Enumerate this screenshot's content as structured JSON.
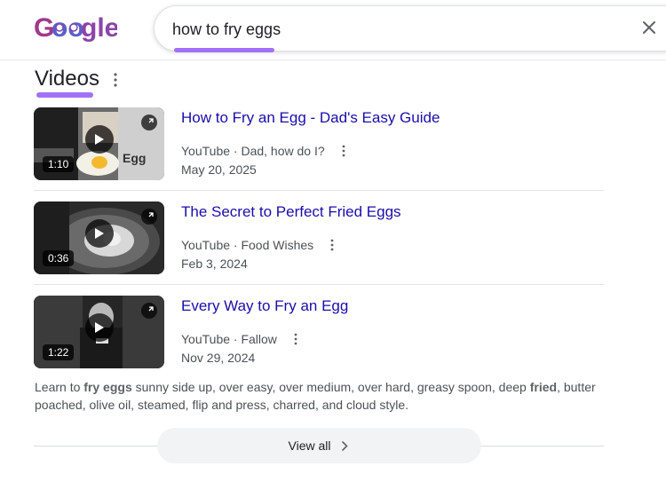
{
  "search": {
    "query": "how to fry eggs",
    "placeholder": "",
    "highlight_color": "#a371f7"
  },
  "logo": {
    "text": "Google"
  },
  "videos_section": {
    "title": "Videos",
    "items": [
      {
        "title": "How to Fry an Egg - Dad's Easy Guide",
        "source": "YouTube · Dad, how do I?",
        "date": "May 20, 2025",
        "duration": "1:10",
        "thumb_caption": "Egg"
      },
      {
        "title": "The Secret to Perfect Fried Eggs",
        "source": "YouTube · Food Wishes",
        "date": "Feb 3, 2024",
        "duration": "0:36"
      },
      {
        "title": "Every Way to Fry an Egg",
        "source": "YouTube · Fallow",
        "date": "Nov 29, 2024",
        "duration": "1:22"
      }
    ]
  },
  "snippet": {
    "prefix": "Learn to ",
    "highlight1": "fry eggs",
    "middle": " sunny side up, over easy, over medium, over hard, greasy spoon, deep ",
    "highlight2": "fried",
    "suffix": ", butter poached, olive oil, steamed, flip and press, charred, and cloud style."
  },
  "view_all": {
    "label": "View all"
  },
  "colors": {
    "link": "#1a0dab",
    "meta": "#4d5156",
    "accent": "#a371f7"
  },
  "icons": {
    "clear": "close-icon",
    "menu": "more-vert-icon",
    "play": "play-icon",
    "expand": "expand-icon",
    "chevron": "chevron-right-icon"
  }
}
